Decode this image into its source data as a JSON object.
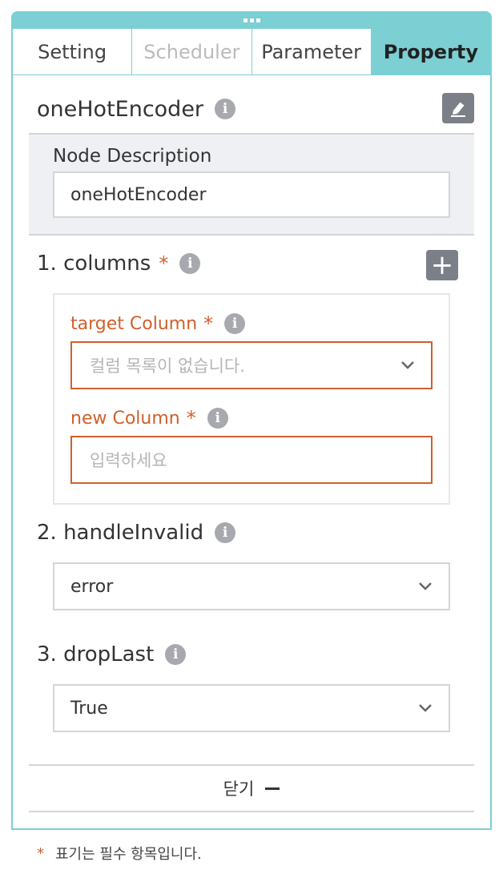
{
  "tabs": [
    {
      "label": "Setting",
      "state": "normal"
    },
    {
      "label": "Scheduler",
      "state": "disabled"
    },
    {
      "label": "Parameter",
      "state": "normal"
    },
    {
      "label": "Property",
      "state": "active"
    }
  ],
  "node": {
    "title": "oneHotEncoder",
    "info_icon": "info-icon",
    "edit_icon": "edit-icon"
  },
  "description": {
    "label": "Node Description",
    "value": "oneHotEncoder"
  },
  "columns": {
    "title": "1. columns",
    "required_mark": "*",
    "add_icon": "+",
    "target_column": {
      "label": "target Column",
      "required_mark": "*",
      "placeholder": "컬럼 목록이 없습니다."
    },
    "new_column": {
      "label": "new Column",
      "required_mark": "*",
      "placeholder": "입력하세요"
    }
  },
  "handle_invalid": {
    "title": "2. handleInvalid",
    "value": "error"
  },
  "drop_last": {
    "title": "3. dropLast",
    "value": "True"
  },
  "close": {
    "label": "닫기"
  },
  "footnote": {
    "mark": "*",
    "text": "표기는 필수 항목입니다."
  },
  "colors": {
    "accent": "#7ccfd3",
    "error": "#d0602c",
    "icon_gray": "#a7a9ae",
    "button_gray": "#7b7f88"
  }
}
